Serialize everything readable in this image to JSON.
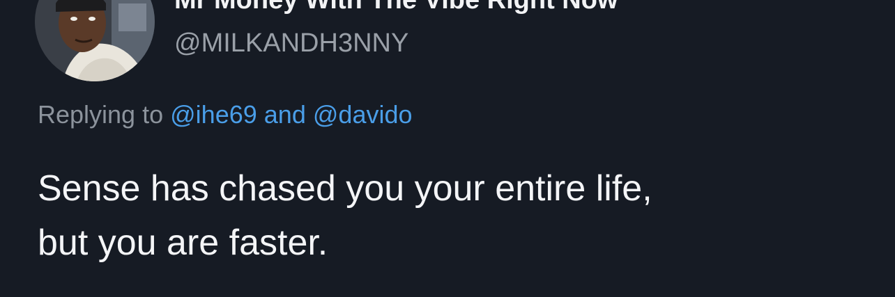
{
  "tweet": {
    "author": {
      "display_name": "Mr Money With The Vibe Right Now",
      "handle": "@MILKANDH3NNY"
    },
    "reply": {
      "prefix": "Replying to",
      "mention_1": "@ihe69",
      "conjunction": "and",
      "mention_2": "@davido"
    },
    "text_lines": [
      "Sense has chased you your entire life,",
      "but you are faster."
    ]
  },
  "icons": {
    "avatar": "profile-photo",
    "more": "more-options-icon"
  },
  "colors": {
    "background": "#161b24",
    "text": "#f4f5f7",
    "secondary_text": "#9aa0a8",
    "link": "#4a9ee8"
  }
}
